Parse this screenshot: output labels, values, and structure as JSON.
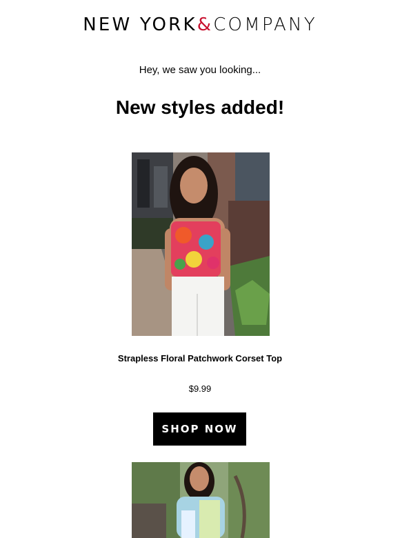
{
  "brand": {
    "logo_part1": "NEW YORK",
    "logo_amp": "&",
    "logo_part2": "COMPANY",
    "accent_color": "#c8102e"
  },
  "email": {
    "intro": "Hey, we saw you looking...",
    "headline": "New styles added!"
  },
  "products": [
    {
      "name": "Strapless Floral Patchwork Corset Top",
      "price": "$9.99",
      "cta": "SHOP NOW"
    }
  ]
}
